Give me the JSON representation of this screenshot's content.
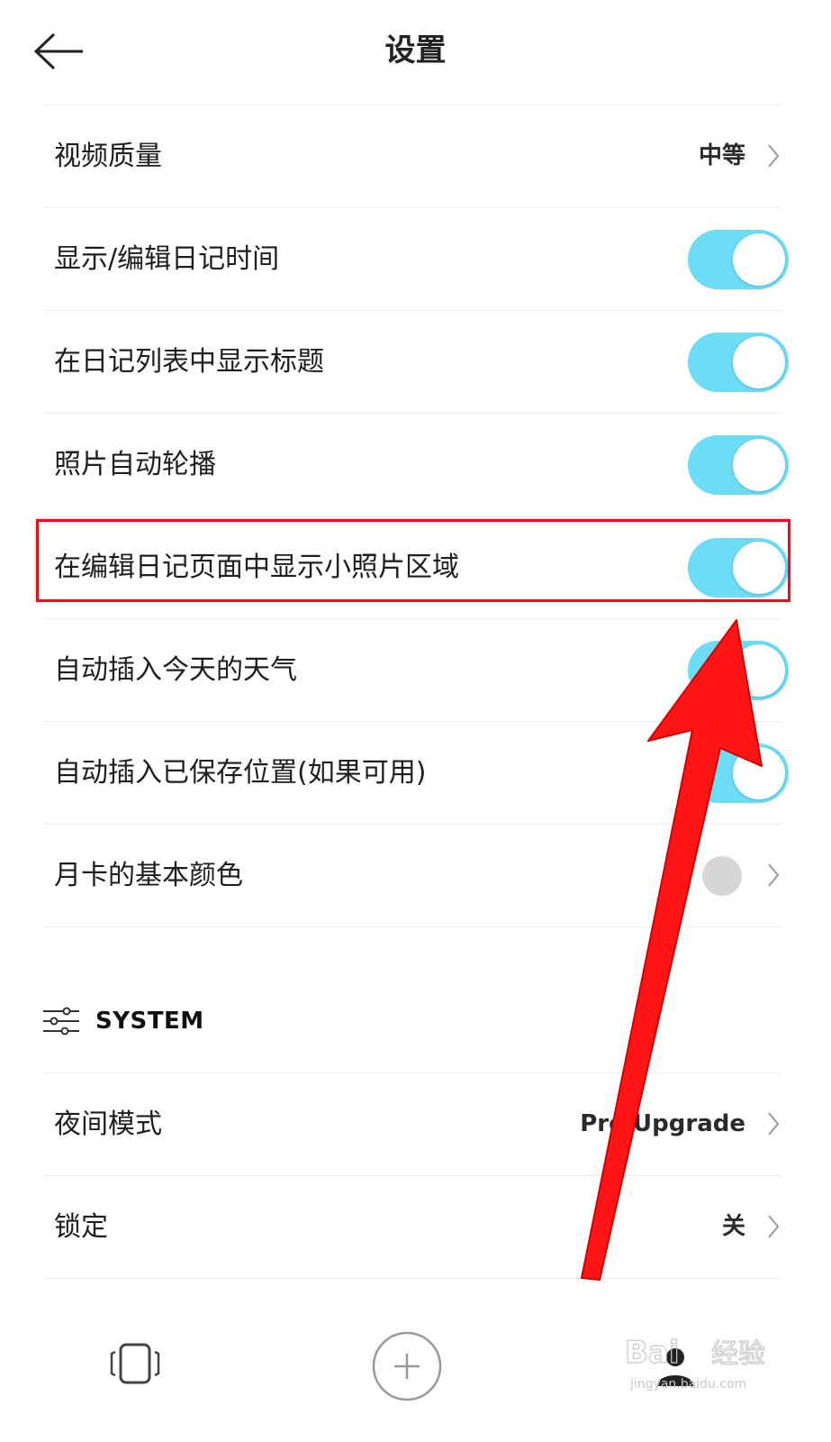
{
  "header": {
    "title": "设置"
  },
  "settings": [
    {
      "label": "视频质量",
      "value": "中等"
    },
    {
      "label": "显示/编辑日记时间",
      "toggle": true
    },
    {
      "label": "在日记列表中显示标题",
      "toggle": true
    },
    {
      "label": "照片自动轮播",
      "toggle": true
    },
    {
      "label": "在编辑日记页面中显示小照片区域",
      "toggle": true
    },
    {
      "label": "自动插入今天的天气",
      "toggle": true
    },
    {
      "label": "自动插入已保存位置(如果可用)",
      "toggle": true
    },
    {
      "label": "月卡的基本颜色",
      "color": "#d6d6d6"
    }
  ],
  "system_section": {
    "title": "SYSTEM",
    "icon": "sliders-icon"
  },
  "system_items": [
    {
      "label": "夜间模式",
      "value": "Pro Upgrade"
    },
    {
      "label": "锁定",
      "value": "关"
    }
  ],
  "tabbar": {
    "icons": [
      "cards-icon",
      "add-icon",
      "profile-icon"
    ]
  },
  "watermark": {
    "text": "Baidu经验",
    "sub": "jingyan.baidu.com"
  },
  "colors": {
    "toggle_on": "#6ddcf5",
    "highlight": "#e8101e",
    "arrow": "#ff0000"
  }
}
